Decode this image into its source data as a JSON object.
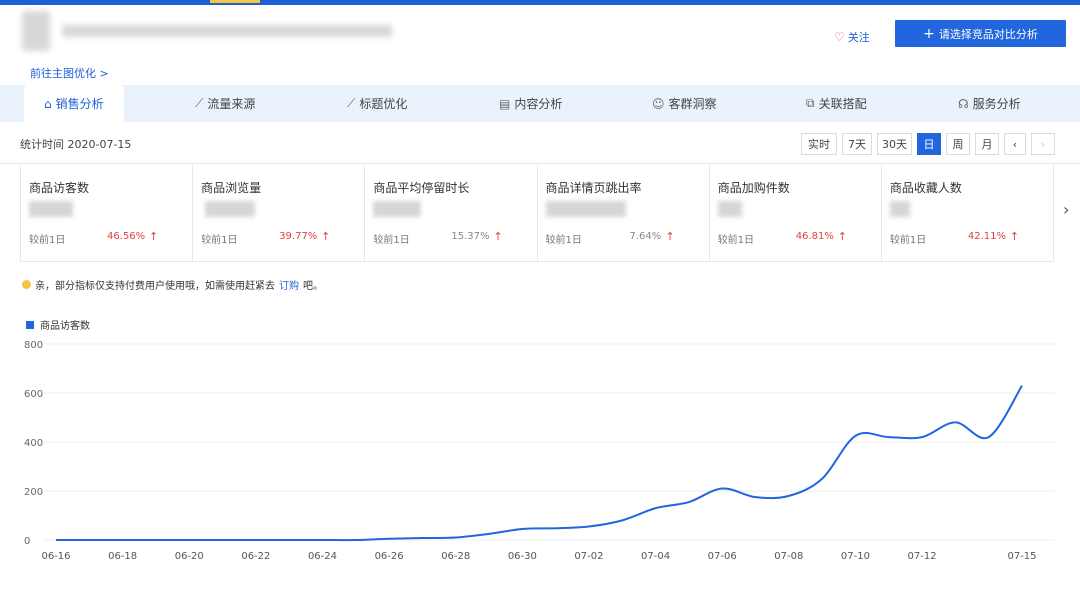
{
  "header": {
    "follow_label": "关注",
    "compare_label": "请选择竞品对比分析",
    "goto_link": "前往主图优化 >"
  },
  "tabs": [
    {
      "label": "销售分析",
      "icon": "bag-icon",
      "glyph": "⌂",
      "active": true
    },
    {
      "label": "流量来源",
      "icon": "trend-icon",
      "glyph": "⟋"
    },
    {
      "label": "标题优化",
      "icon": "chart-icon",
      "glyph": "⟋"
    },
    {
      "label": "内容分析",
      "icon": "document-icon",
      "glyph": "▤"
    },
    {
      "label": "客群洞察",
      "icon": "people-icon",
      "glyph": "☺"
    },
    {
      "label": "关联搭配",
      "icon": "link-icon",
      "glyph": "⧉"
    },
    {
      "label": "服务分析",
      "icon": "headset-icon",
      "glyph": "☊"
    }
  ],
  "toolbar": {
    "stat_time": "统计时间 2020-07-15",
    "periods": [
      "实时",
      "7天",
      "30天",
      "日",
      "周",
      "月"
    ],
    "active_period": "日",
    "prev": "‹",
    "next": "›"
  },
  "metrics": [
    {
      "name": "商品访客数",
      "compare": "较前1日",
      "pct": "46.56%",
      "highlight": true
    },
    {
      "name": "商品浏览量",
      "compare": "较前1日",
      "pct": "39.77%",
      "highlight": true
    },
    {
      "name": "商品平均停留时长",
      "compare": "较前1日",
      "pct": "15.37%",
      "highlight": false
    },
    {
      "name": "商品详情页跳出率",
      "compare": "较前1日",
      "pct": "7.64%",
      "highlight": false
    },
    {
      "name": "商品加购件数",
      "compare": "较前1日",
      "pct": "46.81%",
      "highlight": true
    },
    {
      "name": "商品收藏人数",
      "compare": "较前1日",
      "pct": "42.11%",
      "highlight": true
    }
  ],
  "notice": {
    "text": "亲，部分指标仅支持付费用户使用哦，如需使用赶紧去",
    "link": "订购",
    "suffix": "吧。"
  },
  "colors": {
    "accent": "#2266dd",
    "up": "#e04040"
  },
  "chart_data": {
    "type": "line",
    "series": [
      {
        "name": "商品访客数",
        "x": [
          "06-16",
          "06-17",
          "06-18",
          "06-19",
          "06-20",
          "06-21",
          "06-22",
          "06-23",
          "06-24",
          "06-25",
          "06-26",
          "06-27",
          "06-28",
          "06-29",
          "06-30",
          "07-01",
          "07-02",
          "07-03",
          "07-04",
          "07-05",
          "07-06",
          "07-07",
          "07-08",
          "07-09",
          "07-10",
          "07-11",
          "07-12",
          "07-13",
          "07-14",
          "07-15"
        ],
        "values": [
          0,
          0,
          0,
          0,
          0,
          0,
          0,
          0,
          0,
          0,
          5,
          8,
          10,
          25,
          45,
          48,
          55,
          80,
          130,
          155,
          210,
          175,
          180,
          250,
          425,
          420,
          420,
          480,
          420,
          630
        ]
      }
    ],
    "x_ticks": [
      "06-16",
      "06-18",
      "06-20",
      "06-22",
      "06-24",
      "06-26",
      "06-28",
      "06-30",
      "07-02",
      "07-04",
      "07-06",
      "07-08",
      "07-10",
      "07-12",
      "07-15"
    ],
    "y_ticks": [
      "0",
      "200",
      "400",
      "600",
      "800"
    ],
    "ylim": [
      0,
      800
    ],
    "grid": true,
    "legend_position": "top-left"
  }
}
